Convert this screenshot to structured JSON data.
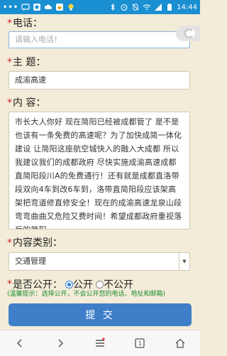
{
  "status_bar": {
    "time": "14:44",
    "dots": "•••"
  },
  "form": {
    "phone": {
      "label": "电话：",
      "placeholder": "请输入电话！"
    },
    "subject": {
      "label": "主 题：",
      "value": "成渝高速"
    },
    "content": {
      "label": "内 容：",
      "value": "市长大人你好  现在简阳已经被成都管了 是不是也该有一条免费的高速呢？为了加快成简一体化建设 让简阳这座航空城快入的融入大成都 所以我建议我们的成都政府 尽快实施成渝高速成都直简阳段川A的免费通行！还有就是成都直洛带段双向4车到改6车到，洛带直简阳段应该架高架把弯道修直修安全！现在的成渝高速龙泉山段弯弯曲曲又危险又费时间！希望成都政府重视落后的简阳"
    },
    "category": {
      "label": "内容类别：",
      "value": "交通管理"
    },
    "public": {
      "label": "是否公开：",
      "options": [
        "公开",
        "不公开"
      ],
      "selected": "公开"
    },
    "hint": "(温馨提示：选择公开，不会公开您的电话、地址和邮箱)",
    "submit_label": "提 交",
    "required_mark": "*"
  },
  "colors": {
    "status_bar": "#1a8fd1",
    "background": "#f2ecd8",
    "submit": "#3f7fc9",
    "hint": "#1d8a2f",
    "required": "#d8262b"
  },
  "nav": {
    "tab_count": "1"
  }
}
